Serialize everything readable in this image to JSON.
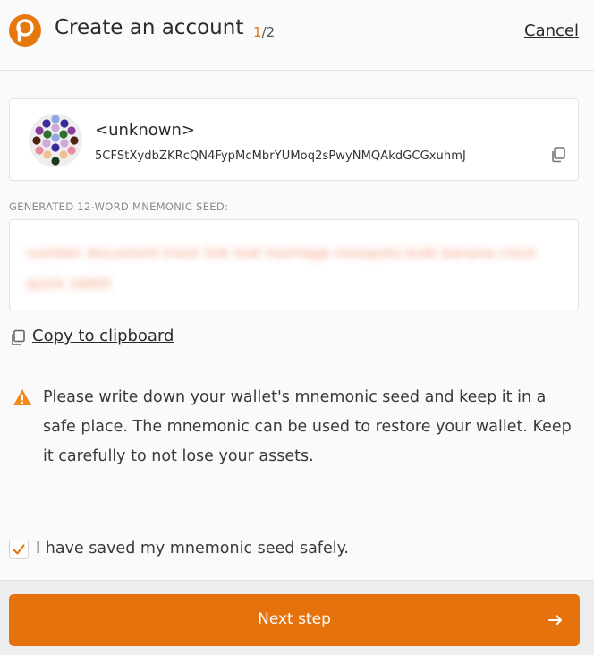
{
  "header": {
    "title": "Create an account",
    "step_current": "1",
    "step_total": "/2",
    "cancel_label": "Cancel",
    "logo_icon": "polkadot-logo",
    "accent_color": "#e6780e"
  },
  "account": {
    "name": "<unknown>",
    "address": "5CFStXydbZKRcQN4FypMcMbrYUMoq2sPwyNMQAkdGCGxuhmJ",
    "identicon": "identicon",
    "copy_icon": "copy-icon"
  },
  "seed": {
    "label": "GENERATED 12-WORD MNEMONIC SEED:",
    "value": "number document track link leaf marriage mosquito bulb banana clock quick rabbit"
  },
  "clipboard": {
    "label": "Copy to clipboard",
    "icon": "copy-icon"
  },
  "warning": {
    "icon": "warning-icon",
    "text": "Please write down your wallet's mnemonic seed and keep it in a safe place. The mnemonic can be used to restore your wallet. Keep it carefully to not lose your assets."
  },
  "confirm": {
    "checked": true,
    "label": "I have saved my mnemonic seed safely."
  },
  "footer": {
    "next_label": "Next step",
    "arrow_icon": "arrow-right-icon",
    "button_color": "#e6720e"
  }
}
